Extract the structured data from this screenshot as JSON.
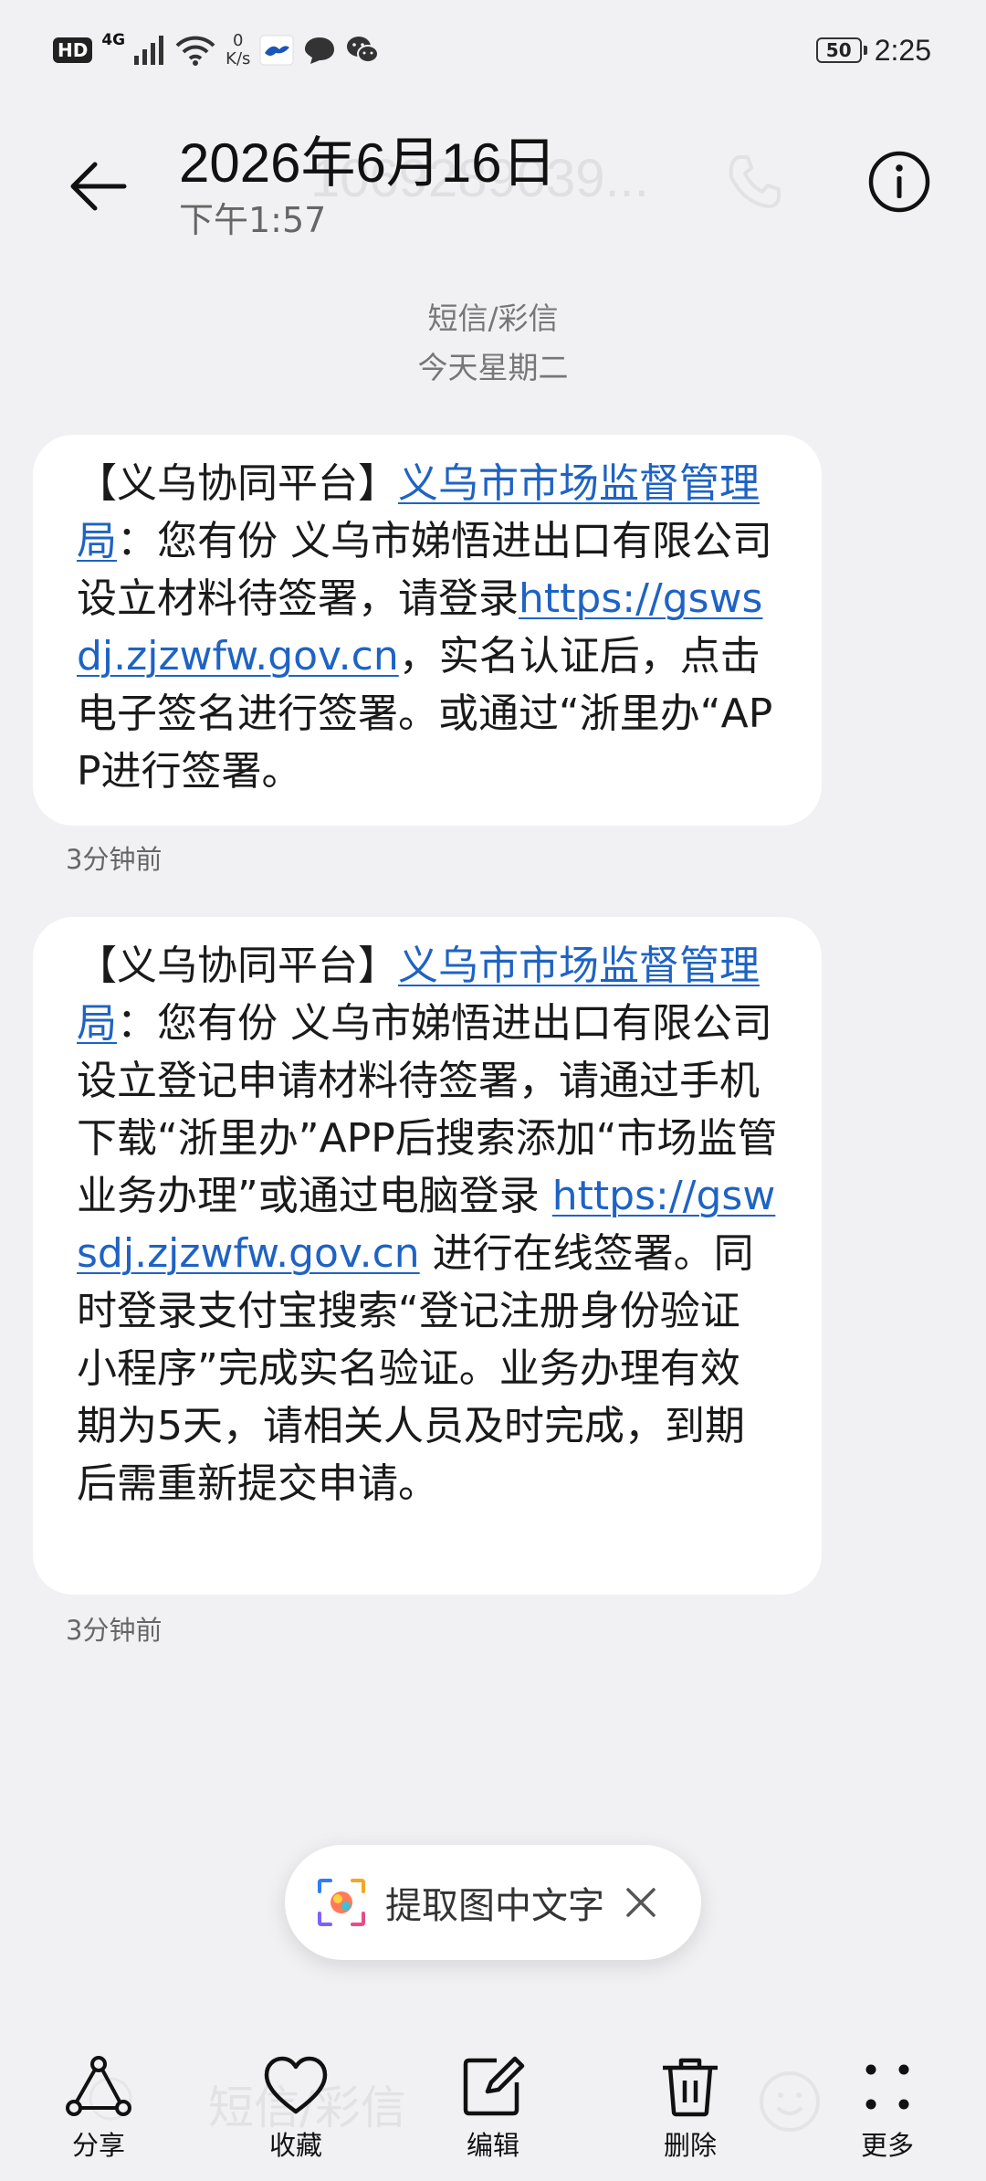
{
  "status_bar": {
    "hd": "HD",
    "network": "4G",
    "speed_value": "0",
    "speed_unit": "K/s",
    "battery": "50",
    "time": "2:25"
  },
  "header": {
    "title": "2026年6月16日",
    "subtitle": "下午1:57",
    "ghost_number": "1069289039..."
  },
  "meta": {
    "channel": "短信/彩信",
    "day": "今天星期二"
  },
  "messages": [
    {
      "prefix": "【义乌协同平台】",
      "sender_link": "义乌市市场监督管理局",
      "body_1": "：您有份 义乌市娣悟进出口有限公司 设立材料待签署，请登录",
      "url": "https://gswsdj.zjzwfw.gov.cn",
      "body_2": "，实名认证后，点击电子签名进行签署。或通过“浙里办“APP进行签署。",
      "time": "3分钟前"
    },
    {
      "prefix": "【义乌协同平台】",
      "sender_link": "义乌市市场监督管理局",
      "body_1": "：您有份 义乌市娣悟进出口有限公司 设立登记申请材料待签署，请通过手机下载“浙里办”APP后搜索添加“市场监管业务办理”或通过电脑登录 ",
      "url": "https://gswsdj.zjzwfw.gov.cn",
      "body_2": " 进行在线签署。同时登录支付宝搜索“登记注册身份验证小程序”完成实名验证。业务办理有效期为5天，请相关人员及时完成，到期后需重新提交申请。",
      "time": "3分钟前"
    }
  ],
  "ocr_pill": {
    "label": "提取图中文字"
  },
  "toolbar": {
    "ghost_input": "短信/彩信",
    "share": "分享",
    "favorite": "收藏",
    "edit": "编辑",
    "delete": "删除",
    "more": "更多"
  },
  "colors": {
    "background": "#f1f1f3",
    "bubble": "#ffffff",
    "link": "#1e63c4"
  }
}
